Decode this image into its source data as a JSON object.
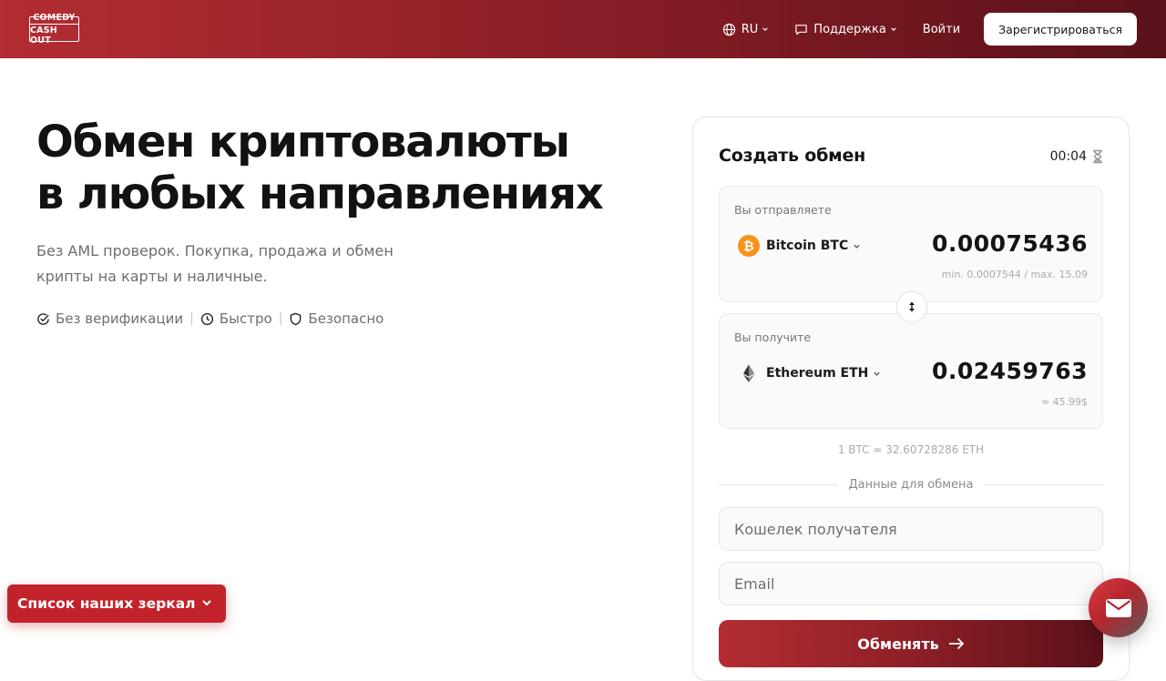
{
  "header": {
    "logo_line1": "COMEDY",
    "logo_line2": "CASH OUT",
    "lang": "RU",
    "support": "Поддержка",
    "login": "Войти",
    "register": "Зарегистрироваться"
  },
  "hero": {
    "title_line1": "Обмен криптовалюты",
    "title_line2": "в любых направлениях",
    "subtitle_line1": "Без AML проверок. Покупка, продажа и обмен",
    "subtitle_line2": "крипты на карты и наличные.",
    "features": [
      "Без верификации",
      "Быстро",
      "Безопасно"
    ],
    "separator": "|"
  },
  "mirrors": {
    "label": "Список наших зеркал"
  },
  "card": {
    "title": "Создать обмен",
    "timer": "00:04",
    "send": {
      "label": "Вы отправляете",
      "coin": "Bitcoin BTC",
      "amount": "0.00075436",
      "limits": "min. 0.0007544 / max. 15.09"
    },
    "receive": {
      "label": "Вы получите",
      "coin": "Ethereum ETH",
      "amount": "0.02459763",
      "usd": "≈ 45.99$"
    },
    "rate": "1 BTC ≈ 32.60728286 ETH",
    "section_label": "Данные для обмена",
    "wallet_placeholder": "Кошелек получателя",
    "email_placeholder": "Email",
    "submit": "Обменять"
  },
  "colors": {
    "brand_red": "#c2232b",
    "brand_dark": "#5a1119",
    "btc_orange": "#f7931a"
  }
}
